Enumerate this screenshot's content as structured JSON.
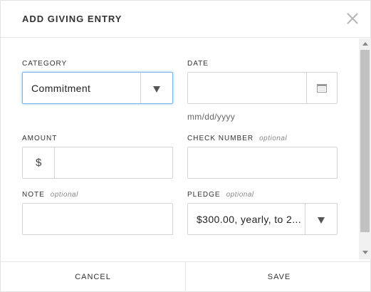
{
  "modal": {
    "title": "ADD GIVING ENTRY",
    "close_icon": "close-icon"
  },
  "form": {
    "category": {
      "label": "CATEGORY",
      "value": "Commitment",
      "icon": "triangle-down-icon"
    },
    "date": {
      "label": "DATE",
      "value": "",
      "hint": "mm/dd/yyyy",
      "icon": "calendar-icon"
    },
    "amount": {
      "label": "AMOUNT",
      "prefix": "$",
      "value": ""
    },
    "check_number": {
      "label": "CHECK NUMBER",
      "optional": "optional",
      "value": ""
    },
    "note": {
      "label": "NOTE",
      "optional": "optional",
      "value": ""
    },
    "pledge": {
      "label": "PLEDGE",
      "optional": "optional",
      "value": "$300.00, yearly, to 2...",
      "icon": "triangle-down-icon"
    }
  },
  "footer": {
    "cancel_label": "CANCEL",
    "save_label": "SAVE"
  },
  "colors": {
    "focus_border": "#7fb6e8",
    "field_border": "#d4d4d4",
    "text": "#333333"
  }
}
